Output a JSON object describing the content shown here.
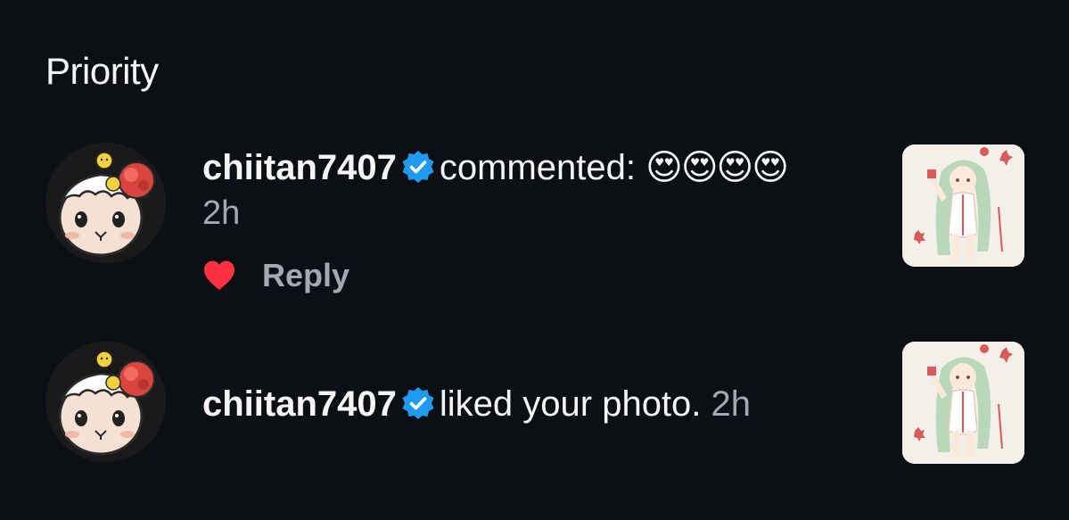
{
  "section": {
    "title": "Priority"
  },
  "notifications": [
    {
      "username": "chiitan7407",
      "verified": true,
      "action_text": "commented:",
      "comment_emojis": "😍😍😍😍",
      "time": "2h",
      "reply_label": "Reply",
      "liked": true,
      "heart_color": "#ff3040",
      "avatar_icon": "bear-mascot-avatar",
      "thumbnail_icon": "anime-girl-illustration"
    },
    {
      "username": "chiitan7407",
      "verified": true,
      "action_text": "liked your photo.",
      "time": "2h",
      "avatar_icon": "bear-mascot-avatar",
      "thumbnail_icon": "anime-girl-illustration"
    }
  ],
  "colors": {
    "background": "#0c0f14",
    "text": "#f5f5f5",
    "secondary": "#a2a9b3",
    "verified_blue": "#1d9bf0"
  }
}
